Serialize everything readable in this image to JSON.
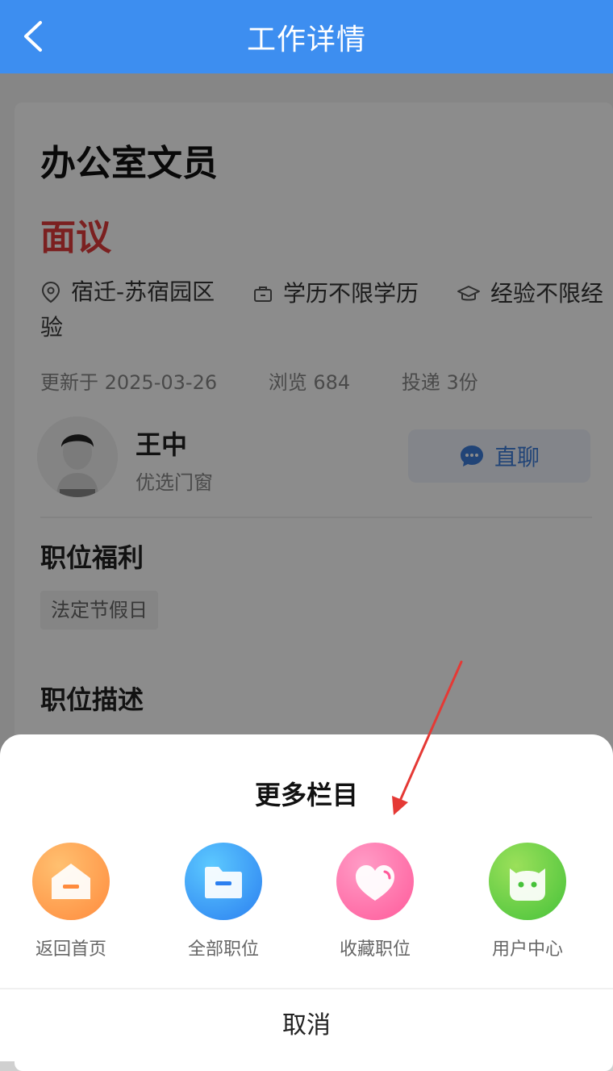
{
  "header": {
    "title": "工作详情"
  },
  "job": {
    "title": "办公室文员",
    "salary": "面议",
    "location": "宿迁-苏宿园区",
    "education": "学历不限学历",
    "experience_head": "经验不限经",
    "experience_tail": "验",
    "updated": "更新于 2025-03-26",
    "views": "浏览 684",
    "applications": "投递 3份"
  },
  "poster": {
    "name": "王中",
    "company": "优选门窗",
    "chat_label": "直聊"
  },
  "sections": {
    "benefits_title": "职位福利",
    "benefits": [
      "法定节假日"
    ],
    "description_title": "职位描述"
  },
  "sheet": {
    "title": "更多栏目",
    "items": [
      {
        "label": "返回首页",
        "icon": "home-icon",
        "color": "#ff9a4a"
      },
      {
        "label": "全部职位",
        "icon": "folder-icon",
        "color": "#3aa2f5"
      },
      {
        "label": "收藏职位",
        "icon": "heart-icon",
        "color": "#ff6aa6"
      },
      {
        "label": "用户中心",
        "icon": "user-center-icon",
        "color": "#5fcf3d"
      }
    ],
    "cancel": "取消"
  },
  "colors": {
    "header": "#3d8ef0",
    "salary": "#e13b3b",
    "annotation_arrow": "#e53935"
  }
}
